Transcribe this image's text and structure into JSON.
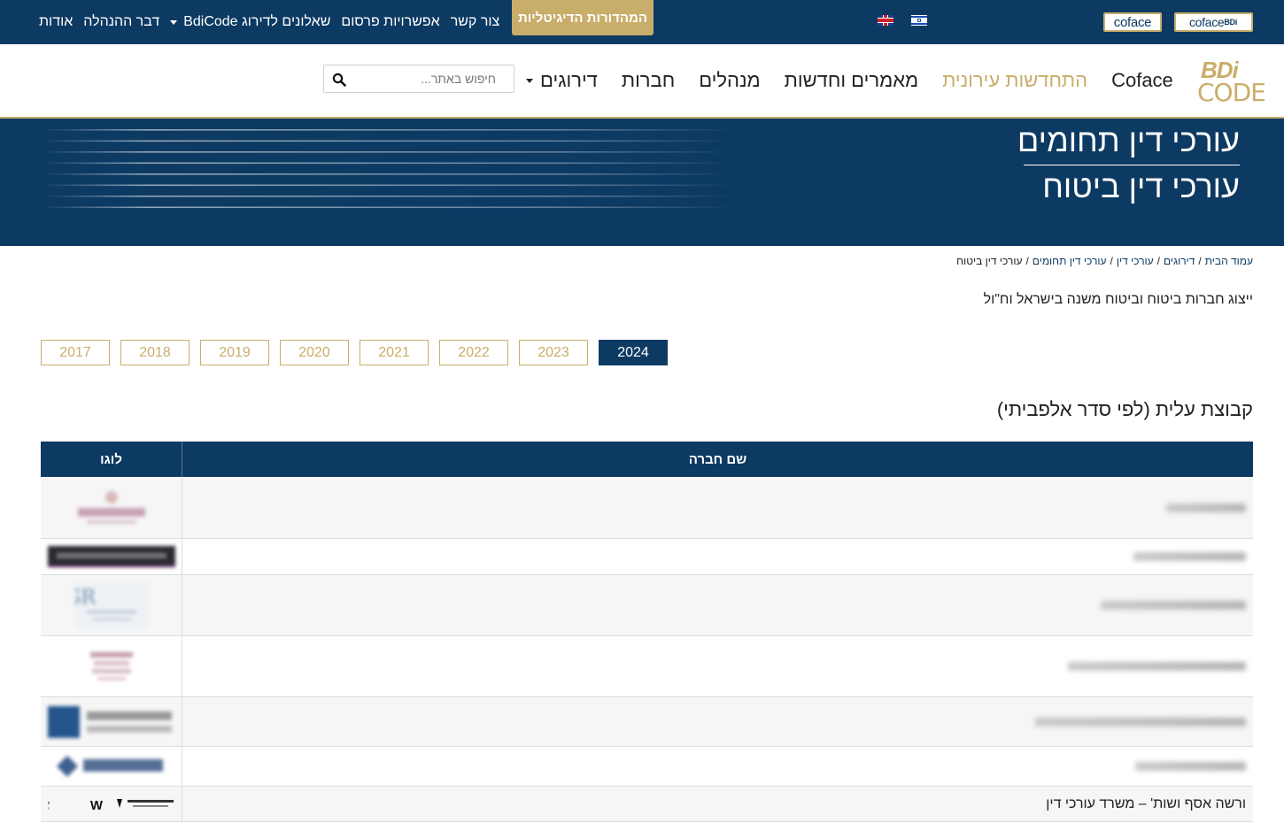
{
  "topbar": {
    "digital_button": "המהדורות הדיגיטליות",
    "links": [
      {
        "label": "אודות",
        "dropdown": false
      },
      {
        "label": "דבר ההנהלה",
        "dropdown": false
      },
      {
        "label": "שאלונים לדירוג BdiCode",
        "dropdown": true
      },
      {
        "label": "אפשרויות פרסום",
        "dropdown": false
      },
      {
        "label": "צור קשר",
        "dropdown": false
      }
    ],
    "languages": [
      "english-flag-icon",
      "israel-flag-icon"
    ],
    "partner_logos": [
      "coface",
      "coface"
    ],
    "partner_logo_suffix": "BDi"
  },
  "mainnav": {
    "logo_line1": "BDi",
    "logo_line2": "CODE",
    "items": [
      {
        "label": "דירוגים",
        "dropdown": true,
        "highlight": false
      },
      {
        "label": "חברות",
        "dropdown": false,
        "highlight": false
      },
      {
        "label": "מנהלים",
        "dropdown": false,
        "highlight": false
      },
      {
        "label": "מאמרים וחדשות",
        "dropdown": false,
        "highlight": false
      },
      {
        "label": "התחדשות עירונית",
        "dropdown": false,
        "highlight": true
      },
      {
        "label": "Coface",
        "dropdown": false,
        "highlight": false
      }
    ],
    "search_placeholder": "חיפוש באתר..."
  },
  "hero": {
    "title": "עורכי דין תחומים",
    "subtitle": "עורכי דין ביטוח"
  },
  "breadcrumb": [
    "עמוד הבית",
    "דירוגים",
    "עורכי דין",
    "עורכי דין תחומים",
    "עורכי דין ביטוח"
  ],
  "intro": "ייצוג חברות ביטוח וביטוח משנה בישראל וח\"ול",
  "years": {
    "items": [
      "2024",
      "2023",
      "2022",
      "2021",
      "2020",
      "2019",
      "2018",
      "2017"
    ],
    "active": "2024"
  },
  "section_title": "קבוצת עלית (לפי סדר אלפביתי)",
  "table": {
    "headers": {
      "name": "שם חברה",
      "logo": "לוגו"
    },
    "rows": [
      {
        "name": "",
        "height": 70
      },
      {
        "name": "",
        "height": 41
      },
      {
        "name": "",
        "height": 69
      },
      {
        "name": "",
        "height": 69
      },
      {
        "name": "",
        "height": 56
      },
      {
        "name": "",
        "height": 45
      },
      {
        "name": "ורשה אסף ושות' – משרד עורכי דין",
        "height": 40
      }
    ],
    "last_row_logo_text": "WARSHA ASAF & Co."
  },
  "colors": {
    "navy": "#0d3a63",
    "gold": "#c9ad6a"
  }
}
